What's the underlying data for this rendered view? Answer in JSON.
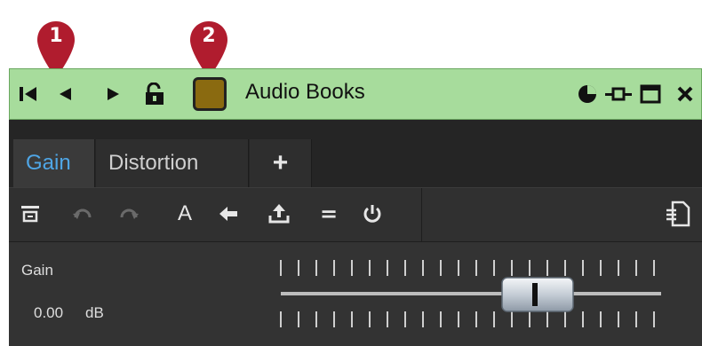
{
  "callouts": [
    "1",
    "2"
  ],
  "colors": {
    "titlebar_bg": "#a7dc9c",
    "track_color": "#8a6a10",
    "accent_active_tab": "#4fa6e6",
    "callout_red": "#b01c2e"
  },
  "titlebar": {
    "title": "Audio Books",
    "icons": [
      "skip-to-start-icon",
      "previous-icon",
      "play-icon",
      "unlock-icon",
      "track-color-swatch",
      "pie-chart-icon",
      "pin-icon",
      "maximize-icon",
      "close-icon"
    ]
  },
  "tabs": [
    {
      "label": "Gain",
      "active": true
    },
    {
      "label": "Distortion",
      "active": false
    }
  ],
  "add_tab_label": "+",
  "toolbar": {
    "icons": [
      "collapse-icon",
      "undo-icon",
      "redo-icon",
      "rename-icon",
      "back-arrow-icon",
      "export-icon",
      "equal-icon",
      "power-icon",
      "preset-menu-icon"
    ],
    "rename_glyph": "A",
    "equal_glyph": "="
  },
  "gain": {
    "label": "Gain",
    "value": "0.00",
    "unit": "dB"
  }
}
